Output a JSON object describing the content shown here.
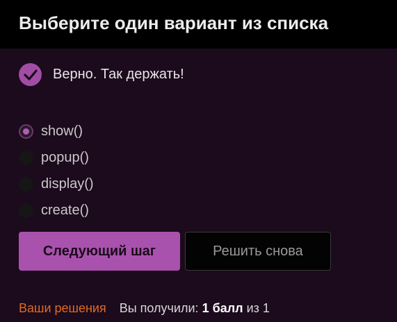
{
  "header": {
    "title": "Выберите один вариант из списка"
  },
  "feedback": {
    "icon": "check-circle-icon",
    "text": "Верно. Так держать!",
    "color": "#a04da4"
  },
  "options": [
    {
      "label": "show()",
      "selected": true
    },
    {
      "label": "popup()",
      "selected": false
    },
    {
      "label": "display()",
      "selected": false
    },
    {
      "label": "create()",
      "selected": false
    }
  ],
  "actions": {
    "next_label": "Следующий шаг",
    "retry_label": "Решить снова"
  },
  "footer": {
    "solutions_link": "Ваши решения",
    "score_prefix": "Вы получили:",
    "score_value": "1 балл",
    "score_suffix": "из 1"
  },
  "colors": {
    "accent": "#a952ad",
    "link": "#e06b1e",
    "background": "#1c0a1d"
  }
}
